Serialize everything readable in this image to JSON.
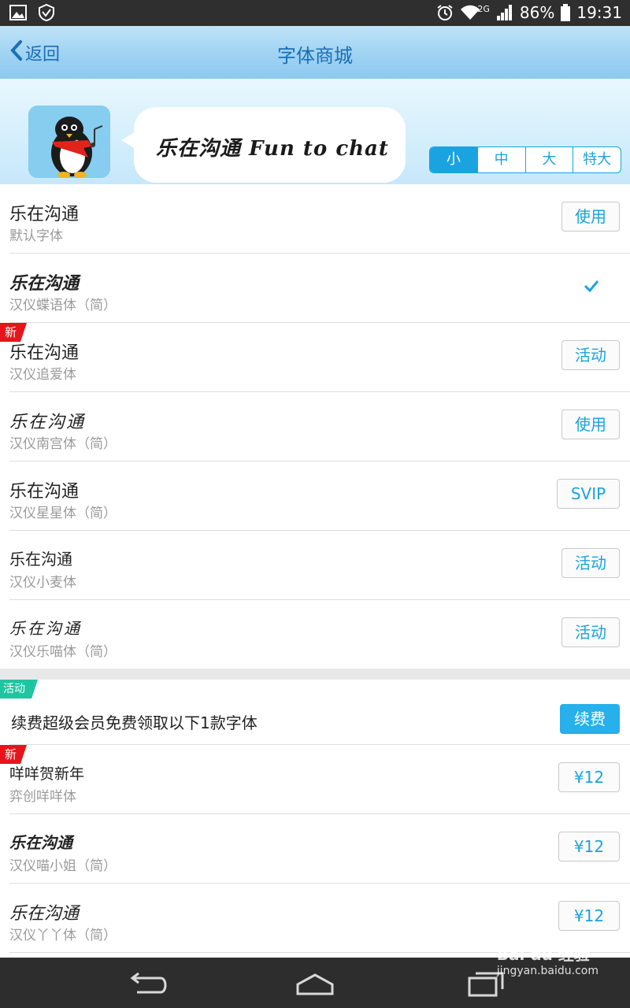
{
  "status_bar": {
    "battery": "86%",
    "time": "19:31",
    "network": "2G"
  },
  "header": {
    "back_label": "返回",
    "title": "字体商城"
  },
  "banner": {
    "preview_text": "乐在沟通 Fun to chat",
    "size_options": [
      "小",
      "中",
      "大",
      "特大"
    ],
    "selected_size": "小"
  },
  "fonts": [
    {
      "name": "乐在沟通",
      "sub": "默认字体",
      "action": "使用"
    },
    {
      "name": "乐在沟通",
      "sub": "汉仪蝶语体（简）",
      "action": ""
    },
    {
      "badge": "新",
      "name": "乐在沟通",
      "sub": "汉仪追爱体",
      "action": "活动"
    },
    {
      "name": "乐在沟通",
      "sub": "汉仪南宫体（简）",
      "action": "使用"
    },
    {
      "name": "乐在沟通",
      "sub": "汉仪星星体（简）",
      "action": "SVIP"
    },
    {
      "name": "乐在沟通",
      "sub": "汉仪小麦体",
      "action": "活动"
    },
    {
      "name": "乐在沟通",
      "sub": "汉仪乐喵体（简）",
      "action": "活动"
    }
  ],
  "promo": {
    "badge": "活动",
    "text": "续费超级会员免费领取以下1款字体",
    "button": "续费"
  },
  "paid_fonts": [
    {
      "badge": "新",
      "name": "咩咩贺新年",
      "sub": "弈创咩咩体",
      "price": "¥12"
    },
    {
      "name": "乐在沟通",
      "sub": "汉仪喵小姐（简）",
      "price": "¥12"
    },
    {
      "name": "乐在沟通",
      "sub": "汉仪丫丫体（简）",
      "price": "¥12"
    }
  ],
  "watermark": {
    "brand": "Bai du 经验",
    "url": "jingyan.baidu.com"
  }
}
